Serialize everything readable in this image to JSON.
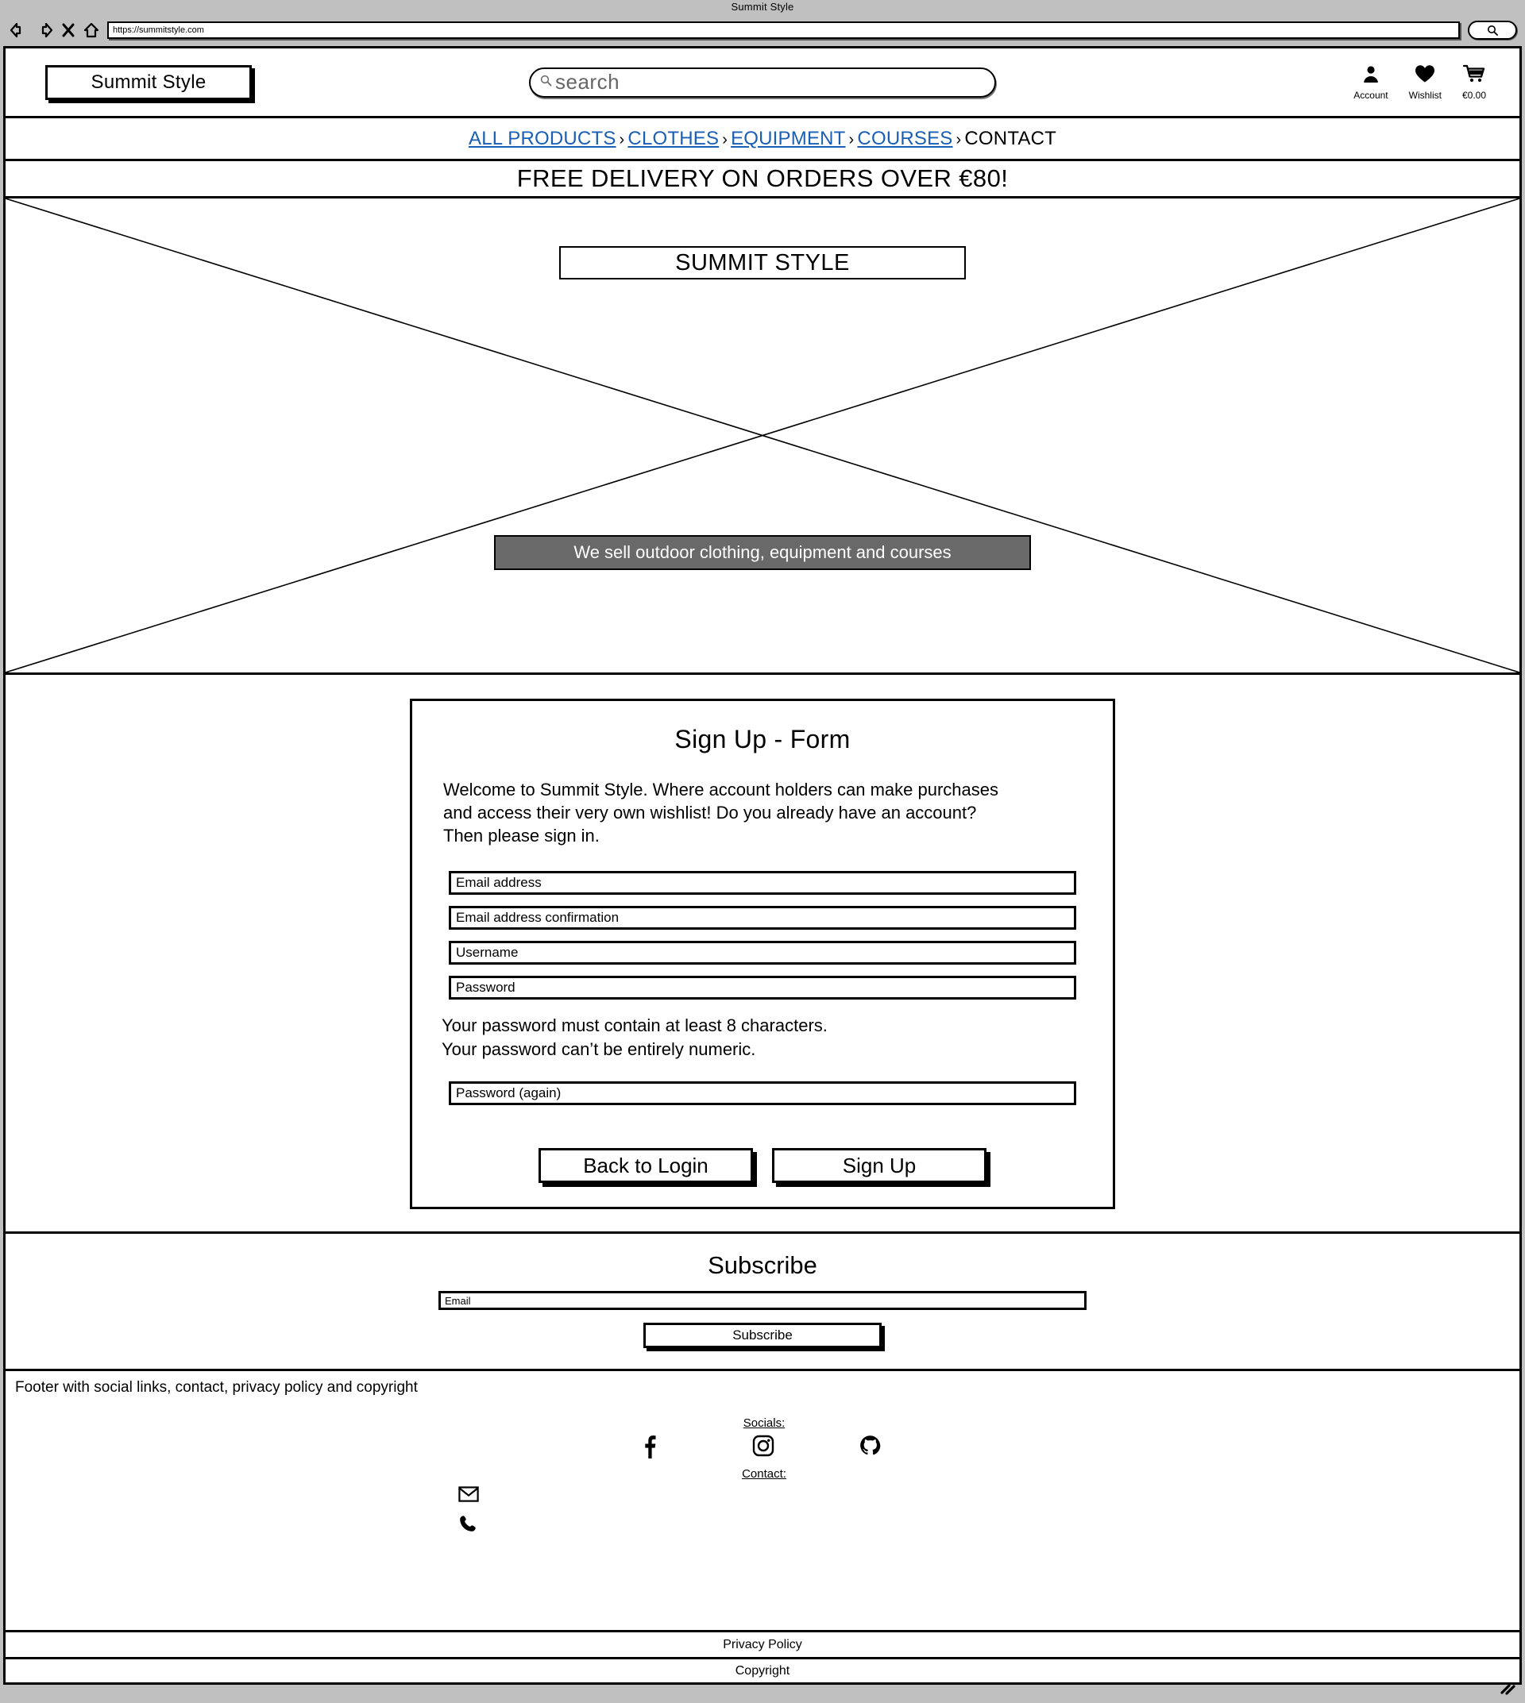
{
  "browser": {
    "window_title": "Summit Style",
    "url": "https://summitstyle.com",
    "back_icon": "back-arrow-icon",
    "forward_icon": "forward-arrow-icon",
    "stop_icon": "close-x-icon",
    "home_icon": "home-icon",
    "search_icon": "search-icon"
  },
  "header": {
    "logo_label": "Summit Style",
    "search_placeholder": "search",
    "actions": [
      {
        "icon": "user-icon",
        "label": "Account"
      },
      {
        "icon": "heart-icon",
        "label": "Wishlist"
      },
      {
        "icon": "cart-icon",
        "label": "€0.00"
      }
    ]
  },
  "nav": {
    "separator": "›",
    "items": [
      {
        "label": "ALL PRODUCTS",
        "is_link": true
      },
      {
        "label": "CLOTHES",
        "is_link": true
      },
      {
        "label": "EQUIPMENT",
        "is_link": true
      },
      {
        "label": "COURSES",
        "is_link": true
      },
      {
        "label": "CONTACT",
        "is_link": false
      }
    ]
  },
  "promo": {
    "text": "FREE DELIVERY ON ORDERS OVER €80!"
  },
  "hero": {
    "title": "SUMMIT STYLE",
    "tagline": "We sell outdoor clothing, equipment and courses",
    "placeholder_icon": "image-placeholder-cross"
  },
  "signup_form": {
    "title": "Sign Up - Form",
    "intro_line1": "Welcome to Summit Style. Where account holders can make purchases",
    "intro_line2": "and access their very own wishlist! Do you already have an account?",
    "intro_line3": "Then please sign in.",
    "fields": [
      {
        "name": "email",
        "placeholder": "Email address",
        "value": ""
      },
      {
        "name": "email_confirmation",
        "placeholder": "Email address confirmation",
        "value": ""
      },
      {
        "name": "username",
        "placeholder": "Username",
        "value": ""
      },
      {
        "name": "password",
        "placeholder": "Password",
        "value": ""
      }
    ],
    "password_rule1": "Your password must contain at least 8 characters.",
    "password_rule2": "Your password can’t be entirely numeric.",
    "password_again_placeholder": "Password (again)",
    "back_button": "Back to Login",
    "signup_button": "Sign Up"
  },
  "subscribe": {
    "title": "Subscribe",
    "email_placeholder": "Email",
    "button_label": "Subscribe"
  },
  "footer": {
    "note": "Footer with social links, contact, privacy policy and copyright",
    "socials_label": "Socials:",
    "contact_label": "Contact:",
    "socials": [
      {
        "icon": "facebook-icon"
      },
      {
        "icon": "instagram-icon"
      },
      {
        "icon": "github-icon"
      }
    ],
    "contacts": [
      {
        "icon": "email-icon"
      },
      {
        "icon": "phone-icon"
      }
    ],
    "privacy_policy": "Privacy Policy",
    "copyright": "Copyright"
  },
  "colors": {
    "chrome": "#c0c0c0",
    "link": "#1a5fb4",
    "tagline_bg": "#696969",
    "border": "#000000"
  }
}
